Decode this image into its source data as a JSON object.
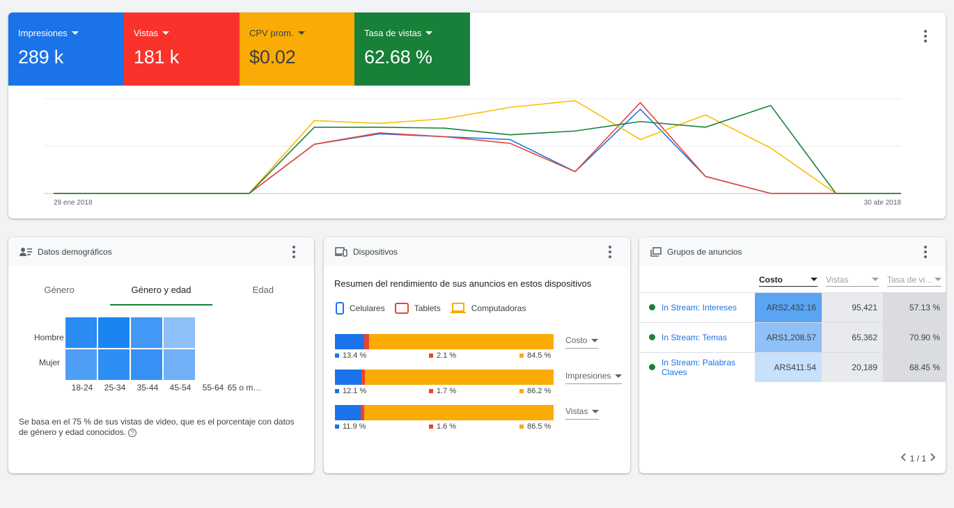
{
  "kpis": [
    {
      "label": "Impresiones",
      "value": "289 k",
      "color": "#1a73e8"
    },
    {
      "label": "Vistas",
      "value": "181 k",
      "color": "#f9332b"
    },
    {
      "label": "CPV prom.",
      "value": "$0.02",
      "color": "#fbab05"
    },
    {
      "label": "Tasa de vistas",
      "value": "62.68 %",
      "color": "#188038"
    }
  ],
  "main_chart": {
    "x_start_label": "29 ene 2018",
    "x_end_label": "30 abr 2018"
  },
  "chart_data": {
    "type": "line",
    "x": [
      "29 ene 2018",
      "",
      "",
      "",
      "",
      "",
      "",
      "",
      "",
      "",
      "",
      "",
      "",
      "30 abr 2018"
    ],
    "ylim": [
      0,
      100
    ],
    "grid": true,
    "legend": "none",
    "series": [
      {
        "name": "Impresiones",
        "color": "#1a73e8",
        "values": [
          0,
          0,
          0,
          0,
          52,
          63,
          60,
          57,
          23,
          89,
          18,
          0,
          0,
          0
        ]
      },
      {
        "name": "Vistas",
        "color": "#ea4335",
        "values": [
          0,
          0,
          0,
          0,
          52,
          64,
          60,
          53,
          23,
          96,
          18,
          0,
          0,
          0
        ]
      },
      {
        "name": "CPV prom.",
        "color": "#fbbc04",
        "values": [
          0,
          0,
          0,
          0,
          77,
          74,
          79,
          91,
          98,
          57,
          83,
          48,
          0,
          0
        ]
      },
      {
        "name": "Tasa de vistas",
        "color": "#188038",
        "values": [
          0,
          0,
          0,
          0,
          70,
          70,
          69,
          62,
          66,
          76,
          70,
          93,
          0,
          0
        ]
      }
    ]
  },
  "demographics": {
    "title": "Datos demográficos",
    "tabs": [
      "Género",
      "Género y edad",
      "Edad"
    ],
    "rows": [
      "Hombre",
      "Mujer"
    ],
    "cols": [
      "18-24",
      "25-34",
      "35-44",
      "45-54",
      "55-64",
      "65 o m…"
    ],
    "cell_colors": [
      [
        "#2b8cf4",
        "#1a85f2",
        "#4298f5",
        "#8dbff8",
        null,
        null
      ],
      [
        "#4e9ef5",
        "#2d8ef4",
        "#3791f4",
        "#70b0f7",
        null,
        null
      ]
    ],
    "note": "Se basa en el 75 % de sus vistas de video, que es el porcentaje con datos de género y edad conocidos.",
    "help": "?"
  },
  "devices": {
    "title": "Dispositivos",
    "subtitle": "Resumen del rendimiento de sus anuncios en estos dispositivos",
    "legend": [
      "Celulares",
      "Tablets",
      "Computadoras"
    ],
    "colors": [
      "#1a73e8",
      "#ea4335",
      "#fbab05"
    ],
    "bars": [
      {
        "metric": "Costo",
        "values": [
          13.4,
          2.1,
          84.5
        ],
        "labels": [
          "13.4 %",
          "2.1 %",
          "84.5 %"
        ]
      },
      {
        "metric": "Impresiones",
        "values": [
          12.1,
          1.7,
          86.2
        ],
        "labels": [
          "12.1 %",
          "1.7 %",
          "86.2 %"
        ]
      },
      {
        "metric": "Vistas",
        "values": [
          11.9,
          1.6,
          86.5
        ],
        "labels": [
          "11.9 %",
          "1.6 %",
          "86.5 %"
        ]
      }
    ]
  },
  "ad_groups": {
    "title": "Grupos de anuncios",
    "columns": [
      "Costo",
      "Vistas",
      "Tasa de vi…"
    ],
    "rows": [
      {
        "name": "In Stream: Intereses",
        "cost": "ARS2,432.16",
        "views": "95,421",
        "rate": "57.13 %",
        "cost_color": "#5aa4f4"
      },
      {
        "name": "In Stream: Temas",
        "cost": "ARS1,208.57",
        "views": "65,362",
        "rate": "70.90 %",
        "cost_color": "#8fc0f8"
      },
      {
        "name": "In Stream: Palabras Claves",
        "cost": "ARS411.54",
        "views": "20,189",
        "rate": "68.45 %",
        "cost_color": "#c7e0fb"
      }
    ],
    "pager": "1 / 1"
  }
}
